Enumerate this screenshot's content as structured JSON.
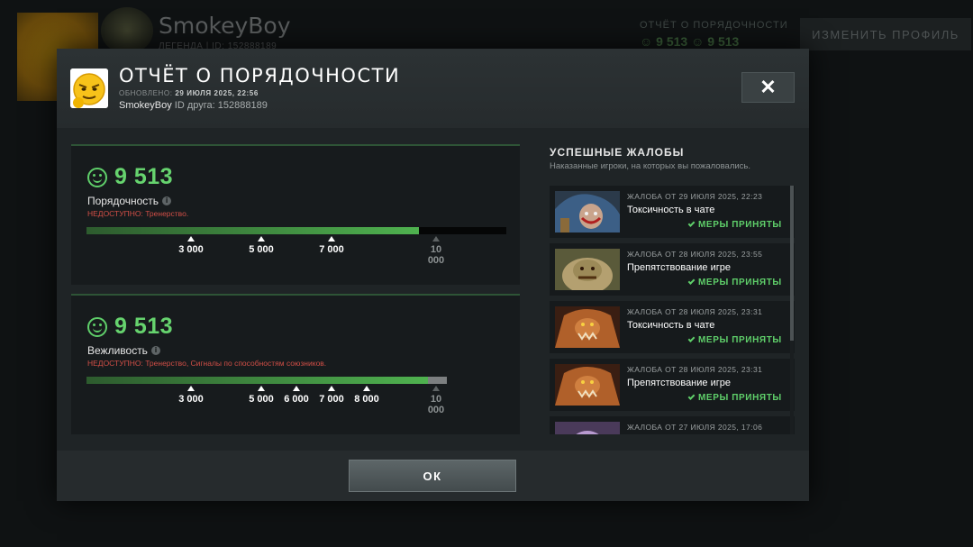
{
  "background": {
    "profile_name": "SmokeyBoy",
    "profile_sub": "ЛЕГЕНДА | ID: 152888189",
    "conduct_label": "ОТЧЁТ О ПОРЯДОЧНОСТИ",
    "conduct_values": "☺ 9 513   ☺ 9 513",
    "edit_profile": "ИЗМЕНИТЬ ПРОФИЛЬ"
  },
  "modal": {
    "title": "ОТЧЁТ О ПОРЯДОЧНОСТИ",
    "updated_label": "ОБНОВЛЕНО:",
    "updated_value": "29 ИЮЛЯ 2025, 22:56",
    "username": "SmokeyBoy",
    "friend_id_label": "ID друга:",
    "friend_id": "152888189",
    "close_glyph": "✕",
    "ok_label": "ОК"
  },
  "conduct": {
    "score": "9 513",
    "label": "Порядочность",
    "unavailable": "НЕДОСТУПНО: Тренерство.",
    "fill_fraction": 0.7925,
    "ticks": [
      "3 000",
      "5 000",
      "7 000",
      "10 000"
    ]
  },
  "politeness": {
    "score": "9 513",
    "label": "Вежливость",
    "unavailable": "НЕДОСТУПНО: Тренерство, Сигналы по способностям союзников.",
    "fill_fraction": 0.9464,
    "ticks": [
      "3 000",
      "5 000",
      "6 000",
      "7 000",
      "8 000",
      "10 000"
    ]
  },
  "reports": {
    "title": "УСПЕШНЫЕ ЖАЛОБЫ",
    "subtitle": "Наказанные игроки, на которых вы пожаловались.",
    "items": [
      {
        "date": "ЖАЛОБА ОТ 29 ИЮЛЯ 2025, 22:23",
        "reason": "Токсичность в чате",
        "status": "МЕРЫ ПРИНЯТЫ",
        "hero": "meepo"
      },
      {
        "date": "ЖАЛОБА ОТ 28 ИЮЛЯ 2025, 23:55",
        "reason": "Препятствование игре",
        "status": "МЕРЫ ПРИНЯТЫ",
        "hero": "pudge"
      },
      {
        "date": "ЖАЛОБА ОТ 28 ИЮЛЯ 2025, 23:31",
        "reason": "Токсичность в чате",
        "status": "МЕРЫ ПРИНЯТЫ",
        "hero": "lifestealer"
      },
      {
        "date": "ЖАЛОБА ОТ 28 ИЮЛЯ 2025, 23:31",
        "reason": "Препятствование игре",
        "status": "МЕРЫ ПРИНЯТЫ",
        "hero": "lifestealer"
      },
      {
        "date": "ЖАЛОБА ОТ 27 ИЮЛЯ 2025, 17:06",
        "reason": "",
        "status": "",
        "hero": "unknown"
      }
    ]
  },
  "colors": {
    "accent_green": "#5fcf6a",
    "warning_red": "#d04e46"
  }
}
